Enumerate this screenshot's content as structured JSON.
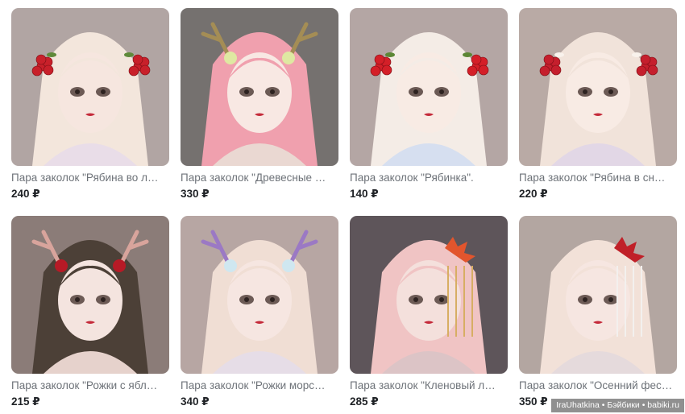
{
  "products": [
    {
      "title": "Пара заколок \"Рябина во л…",
      "price": "240 ₽",
      "image": "doll-hairpins-rowan",
      "palette": {
        "bg": "#b1a5a3",
        "hair": "#f3e6dc",
        "skin": "#f6e6df",
        "accent": "#c8202a",
        "accent2": "#5f8a3a",
        "cloth": "#e9dde8"
      }
    },
    {
      "title": "Пара заколок \"Древесные …",
      "price": "330 ₽",
      "image": "doll-hairpins-wood-antlers",
      "palette": {
        "bg": "#75716f",
        "hair": "#f0a0ae",
        "skin": "#f8e8e3",
        "accent": "#a48d55",
        "accent2": "#dfe8a2",
        "cloth": "#ead8d2"
      }
    },
    {
      "title": "Пара заколок \"Рябинка\".",
      "price": "140 ₽",
      "image": "doll-hairpins-rowanberry",
      "palette": {
        "bg": "#b4a6a4",
        "hair": "#f4ece6",
        "skin": "#f8ebe4",
        "accent": "#d41f28",
        "accent2": "#5c8735",
        "cloth": "#d6dff0"
      }
    },
    {
      "title": "Пара заколок \"Рябина в сн…",
      "price": "220 ₽",
      "image": "doll-hairpins-rowan-snow",
      "palette": {
        "bg": "#b9aaa5",
        "hair": "#f1e3da",
        "skin": "#f8ebe4",
        "accent": "#c51f2d",
        "accent2": "#f9f2ec",
        "cloth": "#e2d7e6"
      }
    },
    {
      "title": "Пара заколок \"Рожки с ябл…",
      "price": "215 ₽",
      "image": "doll-hairpins-antlers-apples",
      "palette": {
        "bg": "#8b7c78",
        "hair": "#4c4037",
        "skin": "#f4e4df",
        "accent": "#d8a49c",
        "accent2": "#b71a26",
        "cloth": "#e6d2cc"
      }
    },
    {
      "title": "Пара заколок \"Рожки морс…",
      "price": "340 ₽",
      "image": "doll-hairpins-sea-antlers",
      "palette": {
        "bg": "#b7a6a3",
        "hair": "#f0ded4",
        "skin": "#f6e6e1",
        "accent": "#9b79c4",
        "accent2": "#cfe7f0",
        "cloth": "#e6dde7"
      }
    },
    {
      "title": "Пара заколок \"Кленовый л…",
      "price": "285 ₽",
      "image": "doll-hairpin-maple-leaf",
      "palette": {
        "bg": "#5e555a",
        "hair": "#f0c4c4",
        "skin": "#f4e0dc",
        "accent": "#e2552d",
        "accent2": "#d7ae63",
        "cloth": "#dcc4c6"
      }
    },
    {
      "title": "Пара заколок \"Осенний фес…",
      "price": "350 ₽",
      "image": "doll-hairpin-autumn-festival",
      "palette": {
        "bg": "#b3a6a1",
        "hair": "#f2e1d8",
        "skin": "#f6e6e1",
        "accent": "#c02028",
        "accent2": "#f3f0ee",
        "cloth": "#e5dadc"
      }
    }
  ],
  "watermark": "IraUhatkina • Бэйбики • babiki.ru"
}
